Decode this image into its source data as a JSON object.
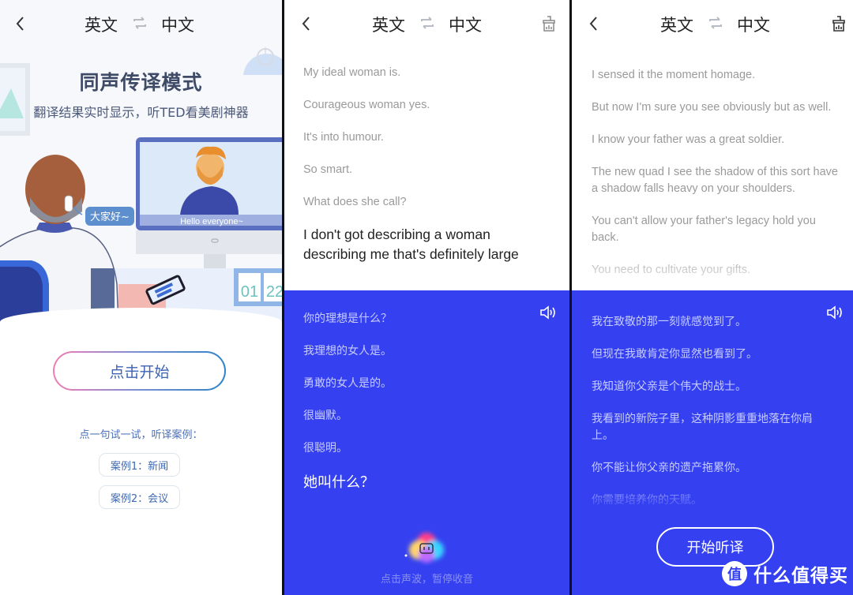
{
  "common": {
    "source_lang": "英文",
    "target_lang": "中文"
  },
  "panel1": {
    "title": "同声传译模式",
    "subtitle": "翻译结果实时显示，听TED看美剧神器",
    "illustration": {
      "bubble_text": "大家好~",
      "subtitle_text": "Hello everyone~",
      "calendar": [
        "01",
        "22"
      ]
    },
    "start_button": "点击开始",
    "try_text": "点一句试一试，听译案例：",
    "cases": [
      "案例1：新闻",
      "案例2：会议"
    ]
  },
  "panel2": {
    "english": [
      "My ideal woman is.",
      "Courageous woman yes.",
      "It's into humour.",
      "So smart.",
      "What does she call?"
    ],
    "english_current": "I don't got describing a woman describing me that's definitely large",
    "chinese": [
      "你的理想是什么？",
      "我理想的女人是。",
      "勇敢的女人是的。",
      "很幽默。",
      "很聪明。"
    ],
    "chinese_current": "她叫什么？",
    "hint": "点击声波，暂停收音"
  },
  "panel3": {
    "english": [
      "I sensed it the moment homage.",
      "But now I'm sure you see obviously but as well.",
      "I know your father was a great soldier.",
      "The new quad I see the shadow of this sort have a shadow falls heavy on your shoulders.",
      "You can't allow your father's legacy hold you back.",
      "You need to cultivate your gifts."
    ],
    "chinese": [
      "我在致敬的那一刻就感觉到了。",
      "但现在我敢肯定你显然也看到了。",
      "我知道你父亲是个伟大的战士。",
      "我看到的新院子里，这种阴影重重地落在你肩上。",
      "你不能让你父亲的遗产拖累你。",
      "你需要培养你的天赋。"
    ],
    "listen_button": "开始听译"
  },
  "watermark": {
    "badge": "值",
    "text": "什么值得买"
  },
  "colors": {
    "accent_blue": "#3541f0",
    "title_text": "#3e4a66",
    "link_blue": "#3e63b4"
  }
}
